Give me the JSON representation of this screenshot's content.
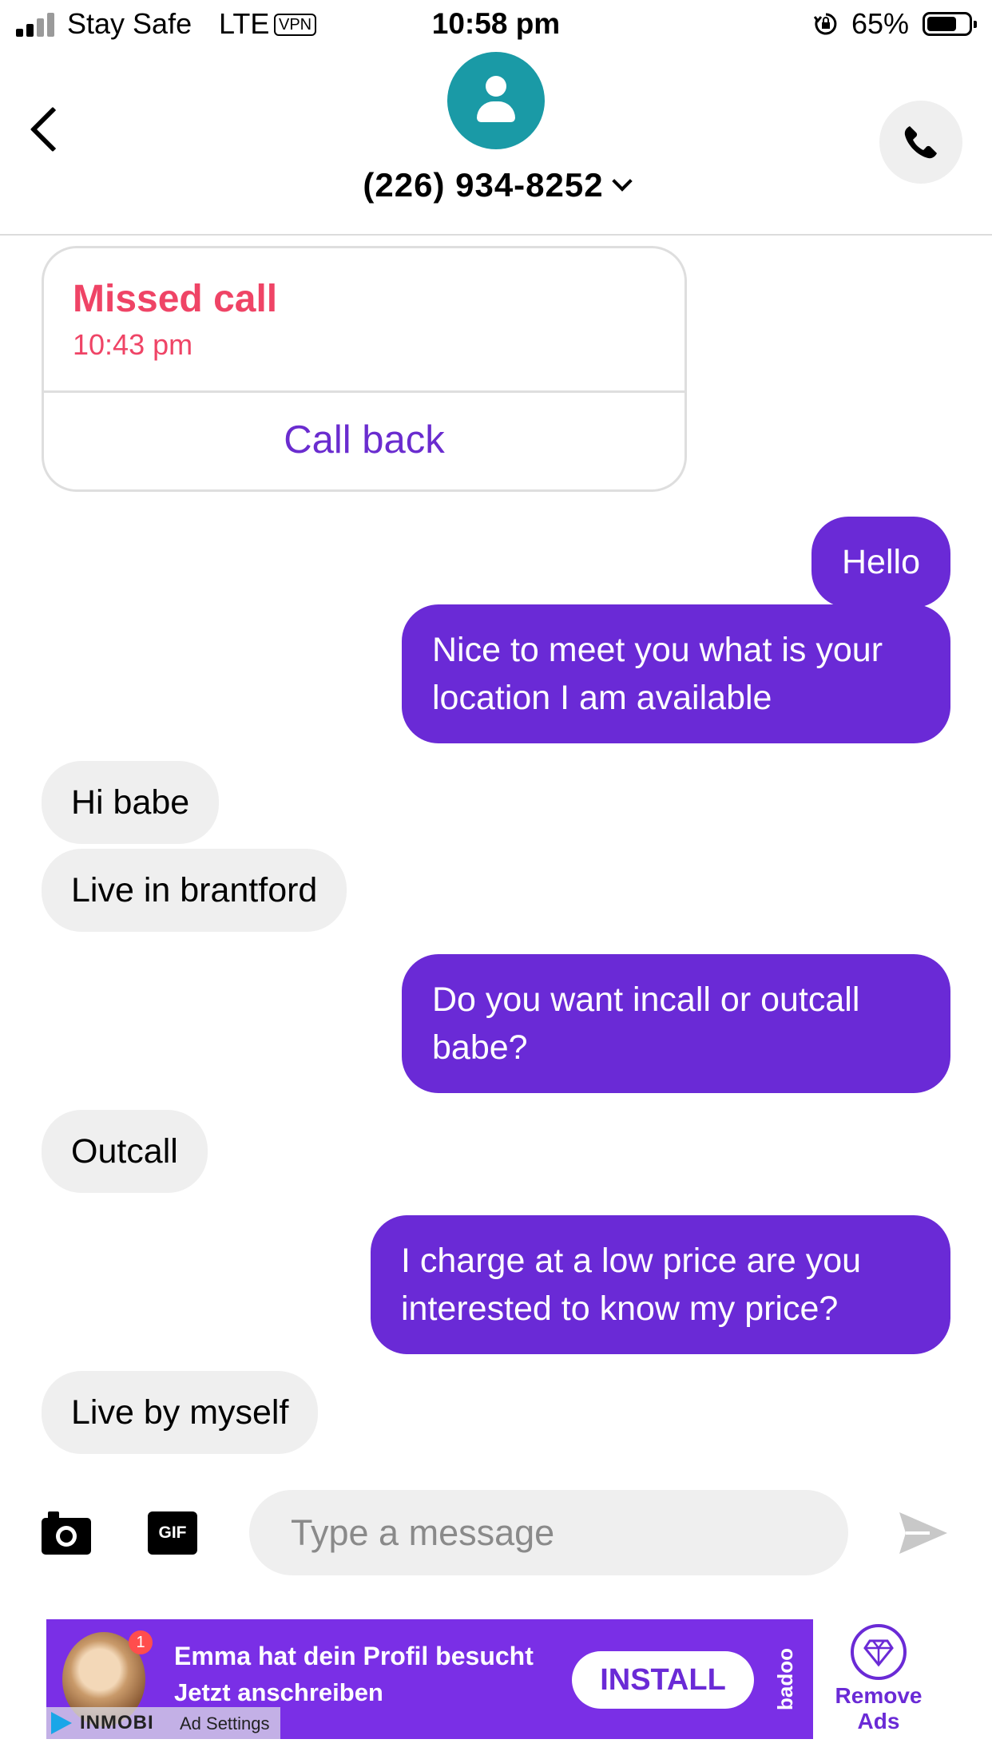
{
  "status_bar": {
    "carrier": "Stay Safe",
    "network": "LTE",
    "vpn": "VPN",
    "time": "10:58 pm",
    "battery": "65%"
  },
  "header": {
    "contact": "(226) 934-8252"
  },
  "missed_call": {
    "title": "Missed call",
    "time": "10:43 pm",
    "action": "Call back"
  },
  "messages": [
    {
      "dir": "out",
      "text": "Hello"
    },
    {
      "dir": "out",
      "text": "Nice to meet you what is your location I am available"
    },
    {
      "dir": "in",
      "text": "Hi babe"
    },
    {
      "dir": "in",
      "text": "Live in brantford"
    },
    {
      "dir": "out",
      "text": "Do you want incall or outcall babe?"
    },
    {
      "dir": "in",
      "text": "Outcall"
    },
    {
      "dir": "out",
      "text": "I charge at a low price are you interested to know my price?"
    },
    {
      "dir": "in",
      "text": "Live by myself"
    }
  ],
  "composer": {
    "gif_label": "GIF",
    "placeholder": "Type a message"
  },
  "ad": {
    "badge": "1",
    "line1": "Emma hat dein Profil besucht",
    "line2": "Jetzt anschreiben",
    "install": "INSTALL",
    "brand": "badoo",
    "network": "INMOBI",
    "settings": "Ad Settings",
    "remove_line1": "Remove",
    "remove_line2": "Ads"
  },
  "colors": {
    "outgoing_bubble": "#6a2ad6",
    "incoming_bubble": "#efefef",
    "missed_call": "#ef4466",
    "avatar": "#1a9aa6"
  }
}
